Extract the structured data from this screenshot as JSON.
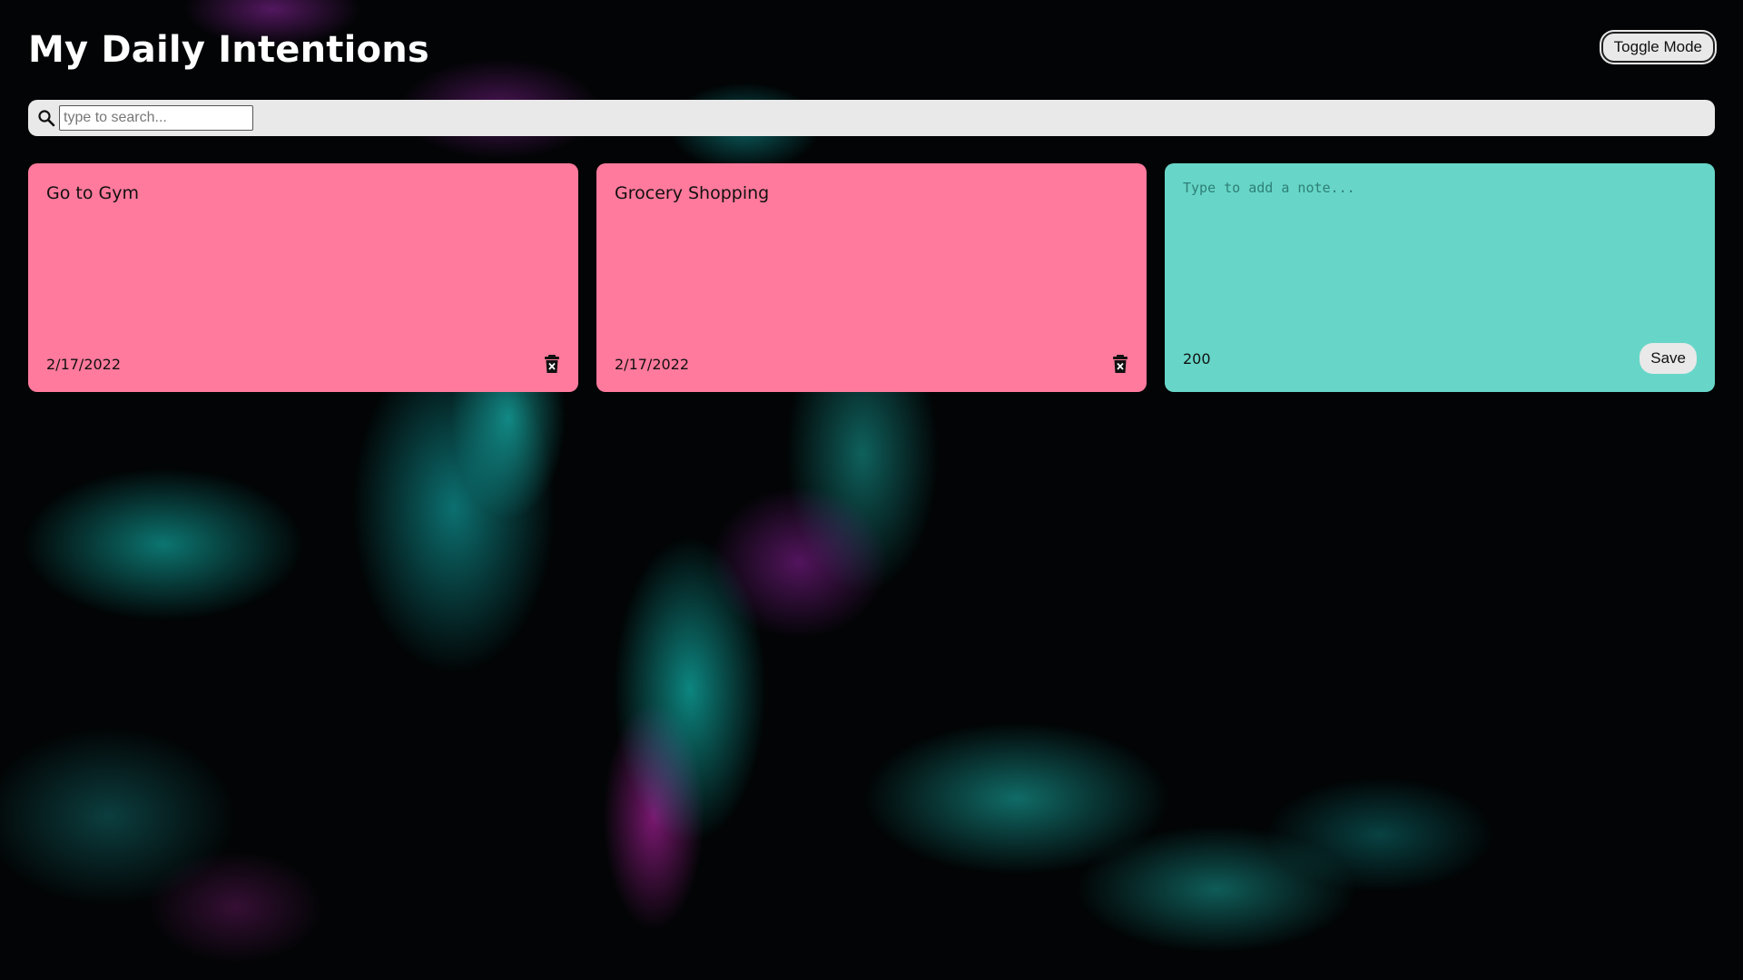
{
  "header": {
    "title": "My Daily Intentions",
    "toggle_label": "Toggle Mode"
  },
  "search": {
    "placeholder": "type to search...",
    "icon": "search-icon"
  },
  "notes": [
    {
      "text": "Go to Gym",
      "date": "2/17/2022",
      "color": "#ff7a9c",
      "delete_icon": "trash-icon"
    },
    {
      "text": "Grocery Shopping",
      "date": "2/17/2022",
      "color": "#ff7a9c",
      "delete_icon": "trash-icon"
    }
  ],
  "new_note": {
    "placeholder": "Type to add a note...",
    "remaining": "200",
    "save_label": "Save",
    "color": "#67d6c8"
  }
}
